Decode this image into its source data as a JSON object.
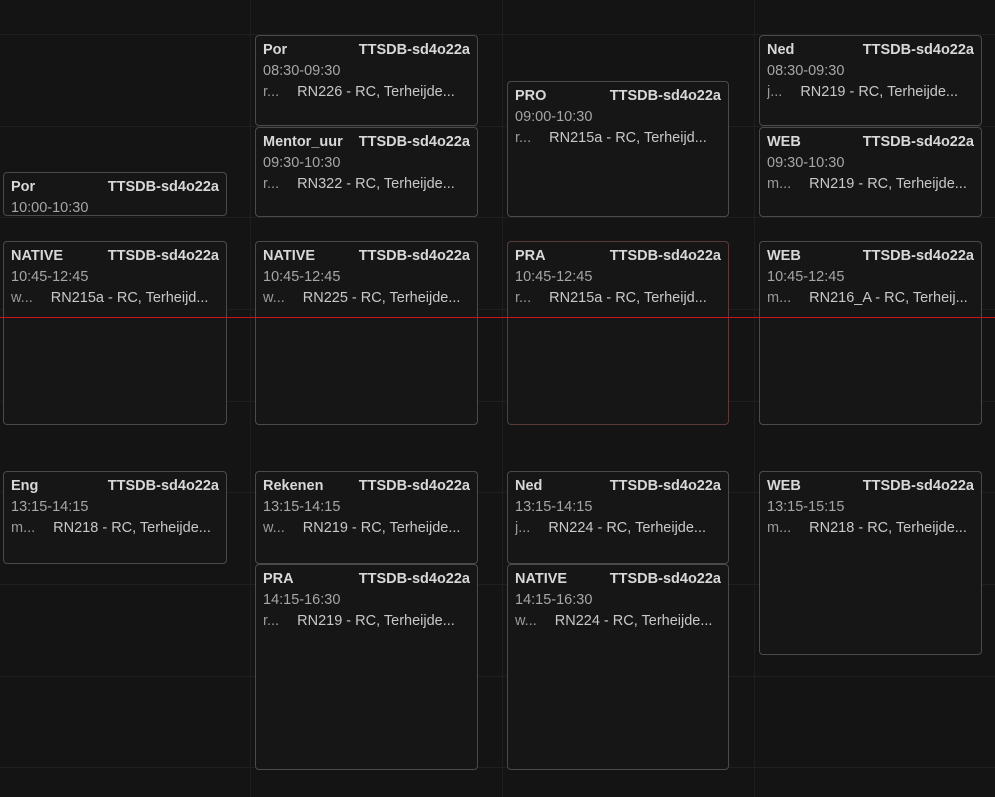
{
  "colors": {
    "background": "#141414",
    "card_border": "#4a4a4a",
    "now_line": "#c8141b"
  },
  "events": [
    {
      "id": "mon-por",
      "title": "Por",
      "class": "TTSDB-sd4o22a",
      "time": "10:00-10:30",
      "teacher": "",
      "room": ""
    },
    {
      "id": "mon-native",
      "title": "NATIVE",
      "class": "TTSDB-sd4o22a",
      "time": "10:45-12:45",
      "teacher": "w...",
      "room": "RN215a - RC, Terheijd..."
    },
    {
      "id": "mon-eng",
      "title": "Eng",
      "class": "TTSDB-sd4o22a",
      "time": "13:15-14:15",
      "teacher": "m...",
      "room": "RN218 - RC, Terheijde..."
    },
    {
      "id": "tue-por",
      "title": "Por",
      "class": "TTSDB-sd4o22a",
      "time": "08:30-09:30",
      "teacher": "r...",
      "room": "RN226 - RC, Terheijde..."
    },
    {
      "id": "tue-mentor",
      "title": "Mentor_uur",
      "class": "TTSDB-sd4o22a",
      "time": "09:30-10:30",
      "teacher": "r...",
      "room": "RN322 - RC, Terheijde..."
    },
    {
      "id": "tue-native",
      "title": "NATIVE",
      "class": "TTSDB-sd4o22a",
      "time": "10:45-12:45",
      "teacher": "w...",
      "room": "RN225 - RC, Terheijde..."
    },
    {
      "id": "tue-rekenen",
      "title": "Rekenen",
      "class": "TTSDB-sd4o22a",
      "time": "13:15-14:15",
      "teacher": "w...",
      "room": "RN219 - RC, Terheijde..."
    },
    {
      "id": "tue-pra",
      "title": "PRA",
      "class": "TTSDB-sd4o22a",
      "time": "14:15-16:30",
      "teacher": "r...",
      "room": "RN219 - RC, Terheijde..."
    },
    {
      "id": "wed-pro",
      "title": "PRO",
      "class": "TTSDB-sd4o22a",
      "time": "09:00-10:30",
      "teacher": "r...",
      "room": "RN215a - RC, Terheijd..."
    },
    {
      "id": "wed-pra",
      "title": "PRA",
      "class": "TTSDB-sd4o22a",
      "time": "10:45-12:45",
      "teacher": "r...",
      "room": "RN215a - RC, Terheijd..."
    },
    {
      "id": "wed-ned",
      "title": "Ned",
      "class": "TTSDB-sd4o22a",
      "time": "13:15-14:15",
      "teacher": "j...",
      "room": "RN224 - RC, Terheijde..."
    },
    {
      "id": "wed-native",
      "title": "NATIVE",
      "class": "TTSDB-sd4o22a",
      "time": "14:15-16:30",
      "teacher": "w...",
      "room": "RN224 - RC, Terheijde..."
    },
    {
      "id": "thu-ned",
      "title": "Ned",
      "class": "TTSDB-sd4o22a",
      "time": "08:30-09:30",
      "teacher": "j...",
      "room": "RN219 - RC, Terheijde..."
    },
    {
      "id": "thu-web1",
      "title": "WEB",
      "class": "TTSDB-sd4o22a",
      "time": "09:30-10:30",
      "teacher": "m...",
      "room": "RN219 - RC, Terheijde..."
    },
    {
      "id": "thu-web2",
      "title": "WEB",
      "class": "TTSDB-sd4o22a",
      "time": "10:45-12:45",
      "teacher": "m...",
      "room": "RN216_A - RC, Terheij..."
    },
    {
      "id": "thu-web3",
      "title": "WEB",
      "class": "TTSDB-sd4o22a",
      "time": "13:15-15:15",
      "teacher": "m...",
      "room": "RN218 - RC, Terheijde..."
    }
  ]
}
